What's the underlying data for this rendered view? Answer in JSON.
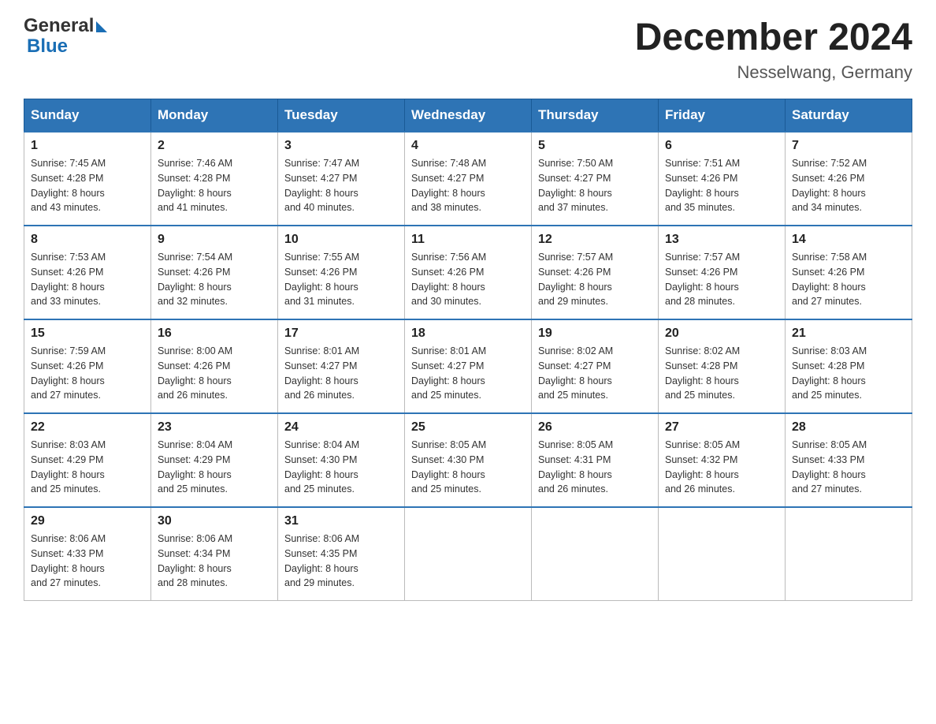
{
  "header": {
    "logo_text_general": "General",
    "logo_text_blue": "Blue",
    "title": "December 2024",
    "subtitle": "Nesselwang, Germany"
  },
  "days_of_week": [
    "Sunday",
    "Monday",
    "Tuesday",
    "Wednesday",
    "Thursday",
    "Friday",
    "Saturday"
  ],
  "weeks": [
    [
      {
        "day": "1",
        "sunrise": "7:45 AM",
        "sunset": "4:28 PM",
        "daylight": "8 hours and 43 minutes."
      },
      {
        "day": "2",
        "sunrise": "7:46 AM",
        "sunset": "4:28 PM",
        "daylight": "8 hours and 41 minutes."
      },
      {
        "day": "3",
        "sunrise": "7:47 AM",
        "sunset": "4:27 PM",
        "daylight": "8 hours and 40 minutes."
      },
      {
        "day": "4",
        "sunrise": "7:48 AM",
        "sunset": "4:27 PM",
        "daylight": "8 hours and 38 minutes."
      },
      {
        "day": "5",
        "sunrise": "7:50 AM",
        "sunset": "4:27 PM",
        "daylight": "8 hours and 37 minutes."
      },
      {
        "day": "6",
        "sunrise": "7:51 AM",
        "sunset": "4:26 PM",
        "daylight": "8 hours and 35 minutes."
      },
      {
        "day": "7",
        "sunrise": "7:52 AM",
        "sunset": "4:26 PM",
        "daylight": "8 hours and 34 minutes."
      }
    ],
    [
      {
        "day": "8",
        "sunrise": "7:53 AM",
        "sunset": "4:26 PM",
        "daylight": "8 hours and 33 minutes."
      },
      {
        "day": "9",
        "sunrise": "7:54 AM",
        "sunset": "4:26 PM",
        "daylight": "8 hours and 32 minutes."
      },
      {
        "day": "10",
        "sunrise": "7:55 AM",
        "sunset": "4:26 PM",
        "daylight": "8 hours and 31 minutes."
      },
      {
        "day": "11",
        "sunrise": "7:56 AM",
        "sunset": "4:26 PM",
        "daylight": "8 hours and 30 minutes."
      },
      {
        "day": "12",
        "sunrise": "7:57 AM",
        "sunset": "4:26 PM",
        "daylight": "8 hours and 29 minutes."
      },
      {
        "day": "13",
        "sunrise": "7:57 AM",
        "sunset": "4:26 PM",
        "daylight": "8 hours and 28 minutes."
      },
      {
        "day": "14",
        "sunrise": "7:58 AM",
        "sunset": "4:26 PM",
        "daylight": "8 hours and 27 minutes."
      }
    ],
    [
      {
        "day": "15",
        "sunrise": "7:59 AM",
        "sunset": "4:26 PM",
        "daylight": "8 hours and 27 minutes."
      },
      {
        "day": "16",
        "sunrise": "8:00 AM",
        "sunset": "4:26 PM",
        "daylight": "8 hours and 26 minutes."
      },
      {
        "day": "17",
        "sunrise": "8:01 AM",
        "sunset": "4:27 PM",
        "daylight": "8 hours and 26 minutes."
      },
      {
        "day": "18",
        "sunrise": "8:01 AM",
        "sunset": "4:27 PM",
        "daylight": "8 hours and 25 minutes."
      },
      {
        "day": "19",
        "sunrise": "8:02 AM",
        "sunset": "4:27 PM",
        "daylight": "8 hours and 25 minutes."
      },
      {
        "day": "20",
        "sunrise": "8:02 AM",
        "sunset": "4:28 PM",
        "daylight": "8 hours and 25 minutes."
      },
      {
        "day": "21",
        "sunrise": "8:03 AM",
        "sunset": "4:28 PM",
        "daylight": "8 hours and 25 minutes."
      }
    ],
    [
      {
        "day": "22",
        "sunrise": "8:03 AM",
        "sunset": "4:29 PM",
        "daylight": "8 hours and 25 minutes."
      },
      {
        "day": "23",
        "sunrise": "8:04 AM",
        "sunset": "4:29 PM",
        "daylight": "8 hours and 25 minutes."
      },
      {
        "day": "24",
        "sunrise": "8:04 AM",
        "sunset": "4:30 PM",
        "daylight": "8 hours and 25 minutes."
      },
      {
        "day": "25",
        "sunrise": "8:05 AM",
        "sunset": "4:30 PM",
        "daylight": "8 hours and 25 minutes."
      },
      {
        "day": "26",
        "sunrise": "8:05 AM",
        "sunset": "4:31 PM",
        "daylight": "8 hours and 26 minutes."
      },
      {
        "day": "27",
        "sunrise": "8:05 AM",
        "sunset": "4:32 PM",
        "daylight": "8 hours and 26 minutes."
      },
      {
        "day": "28",
        "sunrise": "8:05 AM",
        "sunset": "4:33 PM",
        "daylight": "8 hours and 27 minutes."
      }
    ],
    [
      {
        "day": "29",
        "sunrise": "8:06 AM",
        "sunset": "4:33 PM",
        "daylight": "8 hours and 27 minutes."
      },
      {
        "day": "30",
        "sunrise": "8:06 AM",
        "sunset": "4:34 PM",
        "daylight": "8 hours and 28 minutes."
      },
      {
        "day": "31",
        "sunrise": "8:06 AM",
        "sunset": "4:35 PM",
        "daylight": "8 hours and 29 minutes."
      },
      null,
      null,
      null,
      null
    ]
  ],
  "labels": {
    "sunrise": "Sunrise:",
    "sunset": "Sunset:",
    "daylight": "Daylight:"
  }
}
